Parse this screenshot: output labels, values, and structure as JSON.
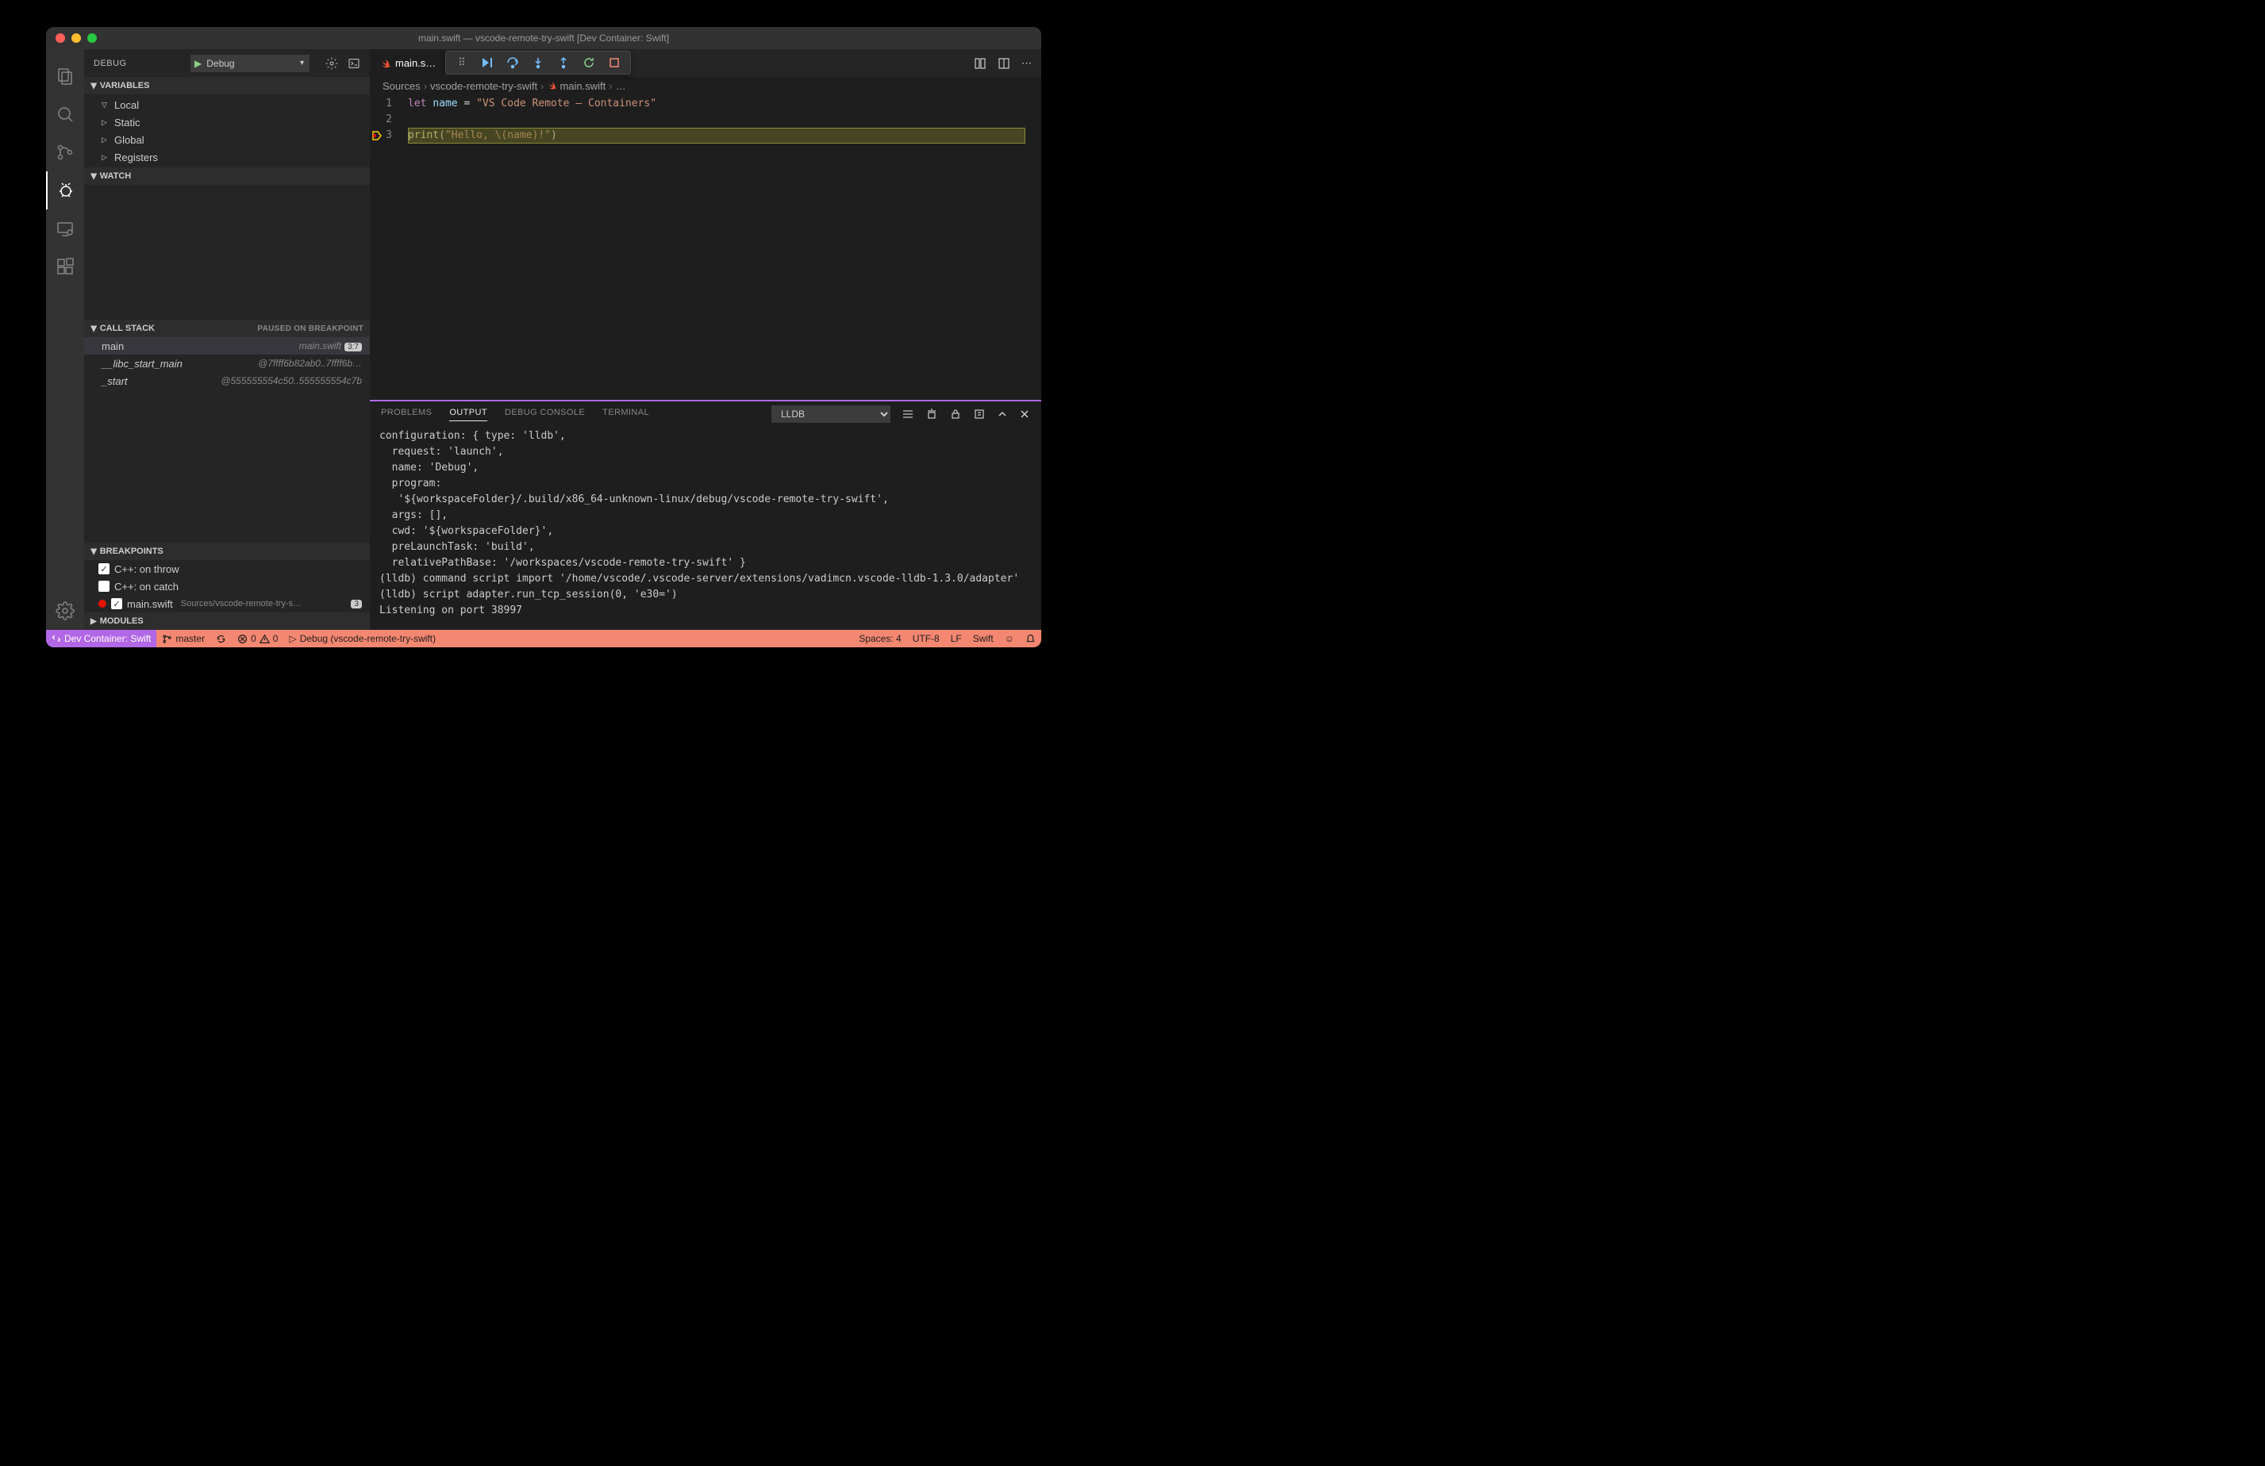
{
  "title": "main.swift — vscode-remote-try-swift [Dev Container: Swift]",
  "sidebar": {
    "title": "DEBUG",
    "config": "Debug",
    "sections": {
      "variables": {
        "label": "VARIABLES",
        "scopes": [
          "Local",
          "Static",
          "Global",
          "Registers"
        ]
      },
      "watch": {
        "label": "WATCH"
      },
      "callstack": {
        "label": "CALL STACK",
        "status": "PAUSED ON BREAKPOINT",
        "frames": [
          {
            "name": "main",
            "loc": "main.swift",
            "badge": "3:7"
          },
          {
            "name": "__libc_start_main",
            "loc": "@7ffff6b82ab0..7ffff6b…"
          },
          {
            "name": "_start",
            "loc": "@555555554c50..555555554c7b"
          }
        ]
      },
      "breakpoints": {
        "label": "BREAKPOINTS",
        "items": [
          {
            "checked": true,
            "label": "C++: on throw"
          },
          {
            "checked": false,
            "label": "C++: on catch"
          },
          {
            "checked": true,
            "label": "main.swift",
            "path": "Sources/vscode-remote-try-s…",
            "badge": "3",
            "redDot": true
          }
        ]
      },
      "modules": {
        "label": "MODULES"
      }
    }
  },
  "tab": {
    "label": "main.s…"
  },
  "breadcrumbs": [
    "Sources",
    "vscode-remote-try-swift",
    "main.swift",
    "…"
  ],
  "code": {
    "lines": [
      {
        "n": "1",
        "tokens": [
          [
            "kw",
            "let"
          ],
          [
            "op",
            " "
          ],
          [
            "var",
            "name"
          ],
          [
            "op",
            " = "
          ],
          [
            "str",
            "\"VS Code Remote – Containers\""
          ]
        ]
      },
      {
        "n": "2",
        "tokens": []
      },
      {
        "n": "3",
        "tokens": [
          [
            "fn",
            "print"
          ],
          [
            "op",
            "("
          ],
          [
            "str",
            "\"Hello, \\(name)!\""
          ],
          [
            "op",
            ")"
          ]
        ],
        "current": true
      }
    ]
  },
  "panel": {
    "tabs": [
      "PROBLEMS",
      "OUTPUT",
      "DEBUG CONSOLE",
      "TERMINAL"
    ],
    "active": "OUTPUT",
    "channel": "LLDB",
    "output": "configuration: { type: 'lldb',\n  request: 'launch',\n  name: 'Debug',\n  program:\n   '${workspaceFolder}/.build/x86_64-unknown-linux/debug/vscode-remote-try-swift',\n  args: [],\n  cwd: '${workspaceFolder}',\n  preLaunchTask: 'build',\n  relativePathBase: '/workspaces/vscode-remote-try-swift' }\n(lldb) command script import '/home/vscode/.vscode-server/extensions/vadimcn.vscode-lldb-1.3.0/adapter'\n(lldb) script adapter.run_tcp_session(0, 'e30=')\nListening on port 38997"
  },
  "status": {
    "remote": "Dev Container: Swift",
    "branch": "master",
    "errors": "0",
    "warnings": "0",
    "debug": "Debug (vscode-remote-try-swift)",
    "spaces": "Spaces: 4",
    "encoding": "UTF-8",
    "eol": "LF",
    "lang": "Swift"
  }
}
